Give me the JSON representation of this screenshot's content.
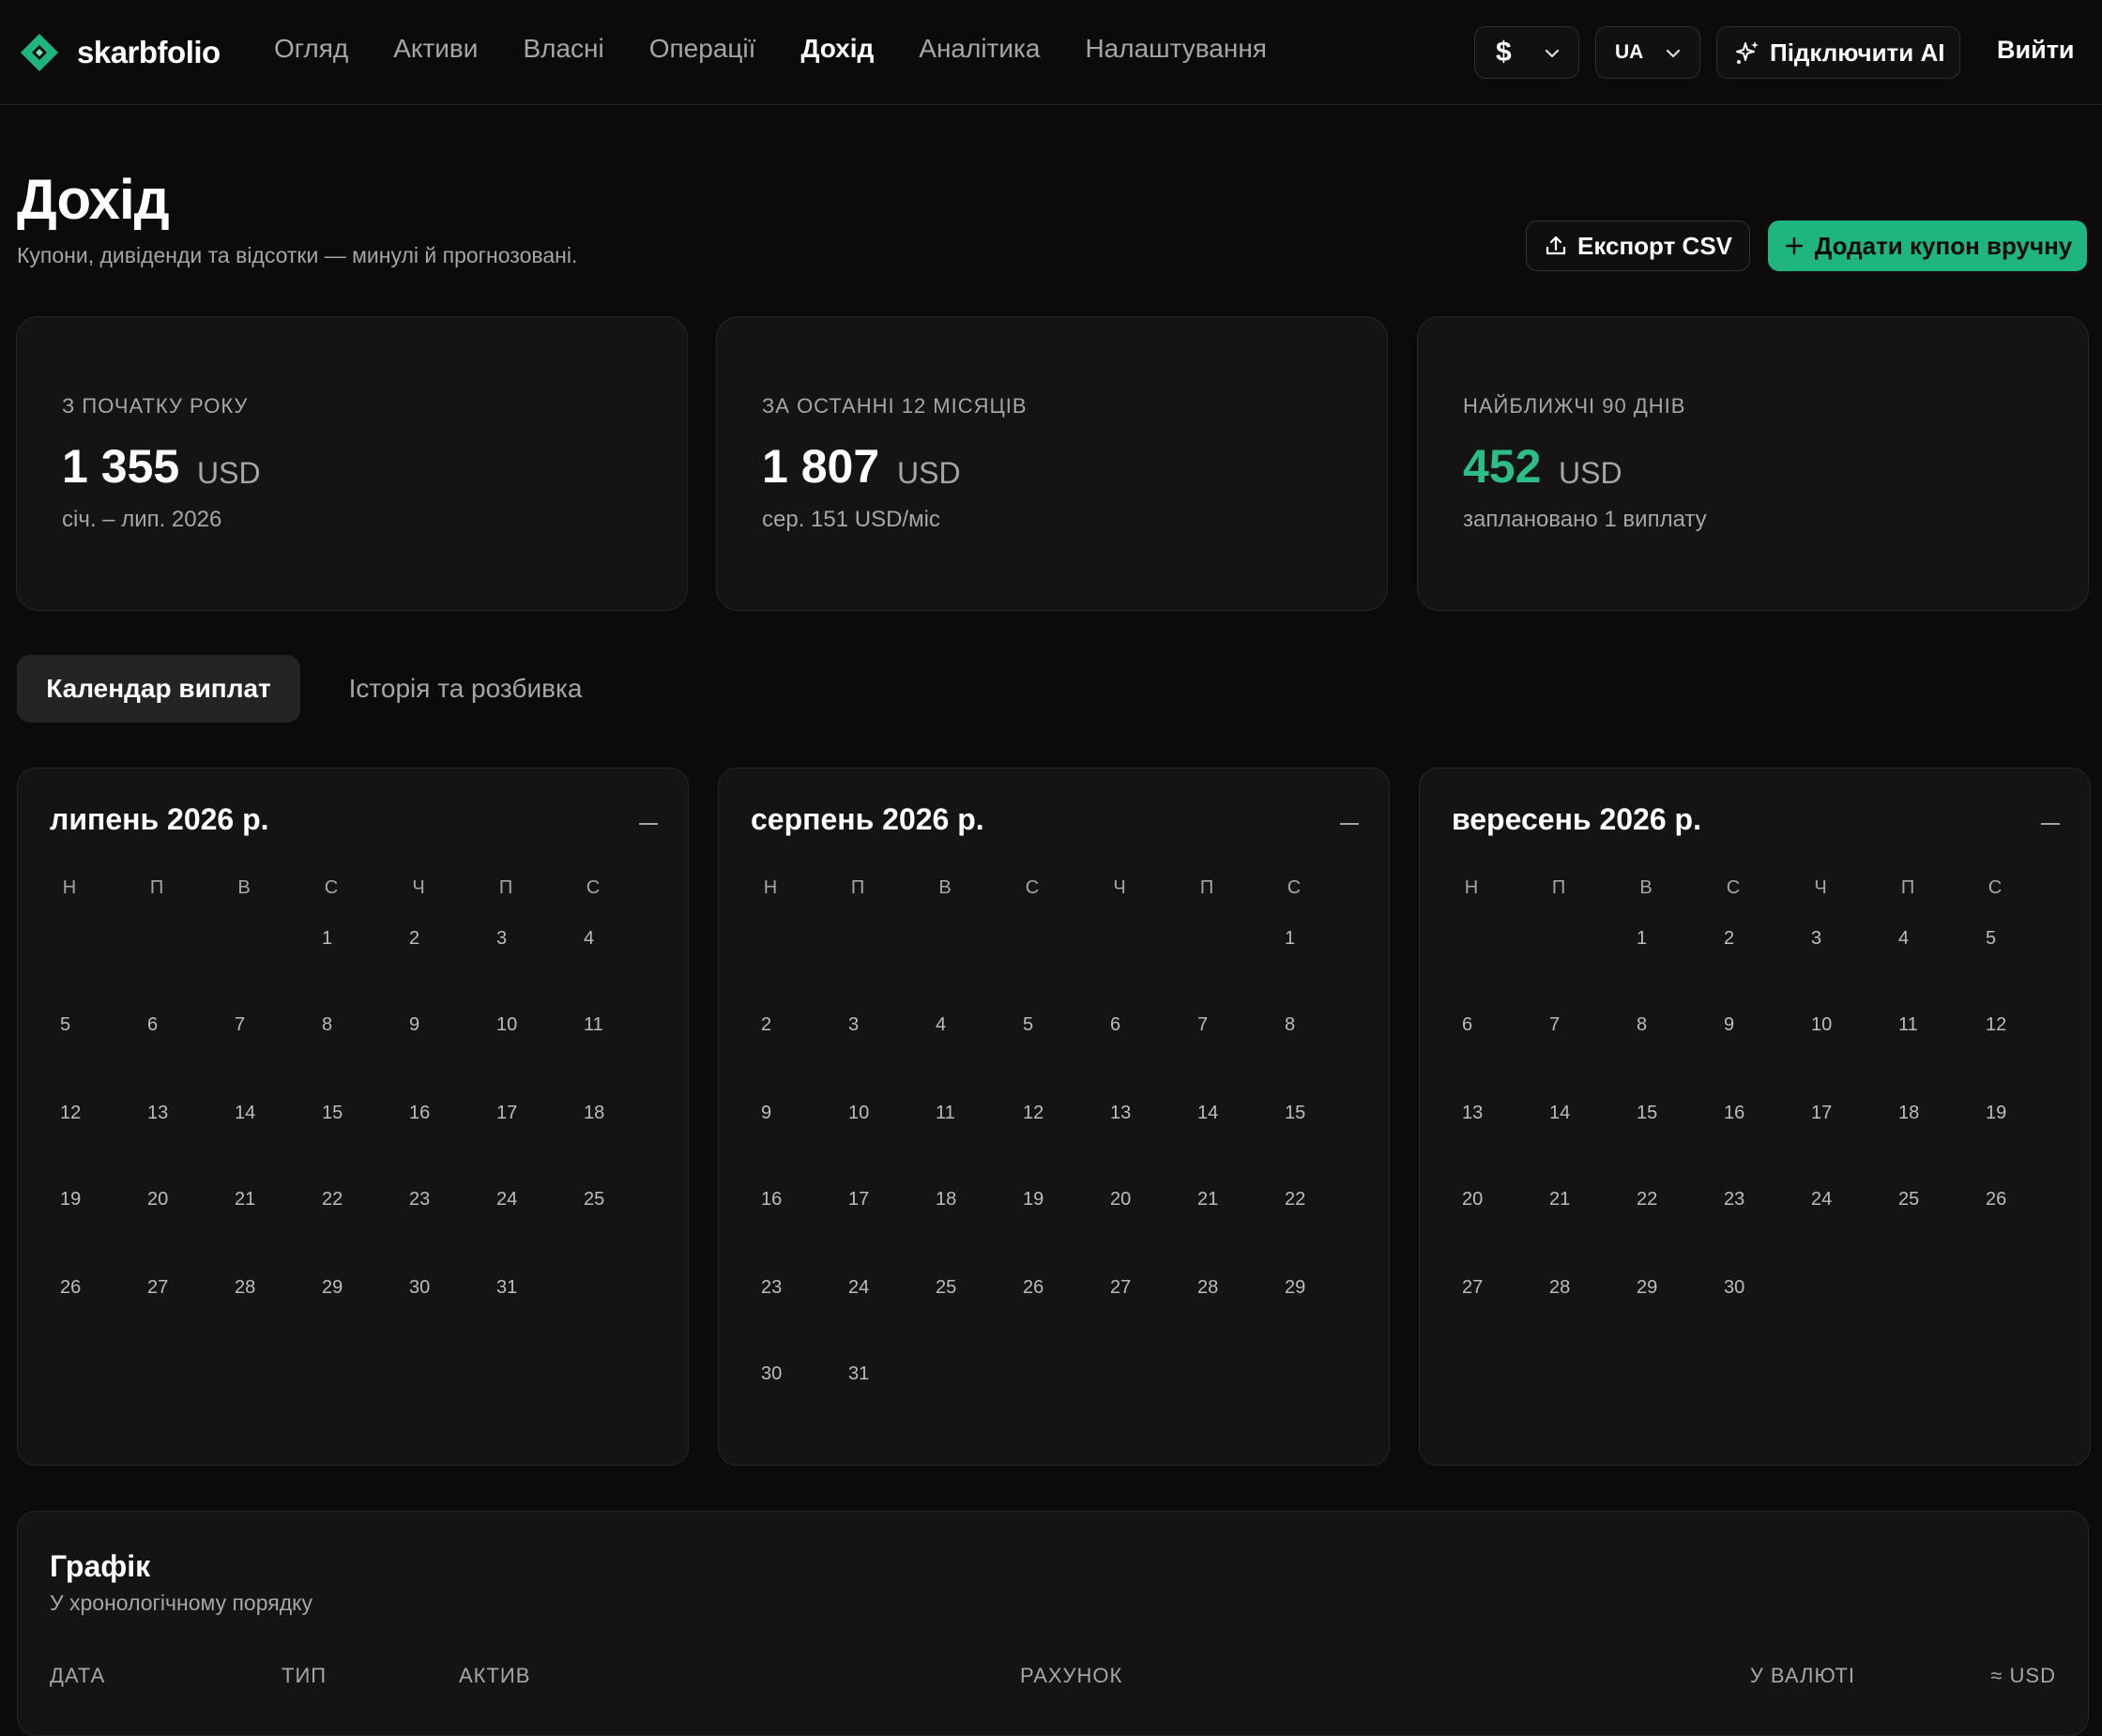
{
  "app": {
    "name": "skarbfolio",
    "brand_color": "#1fb57e"
  },
  "nav": {
    "items": [
      "Огляд",
      "Активи",
      "Власні",
      "Операції",
      "Дохід",
      "Аналітика",
      "Налаштування"
    ],
    "active": "Дохід"
  },
  "header": {
    "currency": "$",
    "language": "UA",
    "ai_button": "Підключити AI",
    "logout": "Вийти"
  },
  "page": {
    "title": "Дохід",
    "subtitle": "Купони, дивіденди та відсотки — минулі й прогнозовані."
  },
  "actions": {
    "export": "Експорт CSV",
    "add": "Додати купон вручну"
  },
  "stats": [
    {
      "label": "З ПОЧАТКУ РОКУ",
      "value": "1 355",
      "unit": "USD",
      "sub": "січ. – лип. 2026"
    },
    {
      "label": "ЗА ОСТАННІ 12 МІСЯЦІВ",
      "value": "1 807",
      "unit": "USD",
      "sub": "сер. 151 USD/міс"
    },
    {
      "label": "НАЙБЛИЖЧІ 90 ДНІВ",
      "value": "452",
      "unit": "USD",
      "sub": "заплановано 1 виплату"
    }
  ],
  "tabs": [
    "Календар виплат",
    "Історія та розбивка"
  ],
  "weekdays": [
    "Н",
    "П",
    "В",
    "С",
    "Ч",
    "П",
    "С"
  ],
  "calendars": [
    {
      "title": "липень 2026 р.",
      "first_weekday": 3,
      "days": 31
    },
    {
      "title": "серпень 2026 р.",
      "first_weekday": 6,
      "days": 31
    },
    {
      "title": "вересень 2026 р.",
      "first_weekday": 2,
      "days": 30
    }
  ],
  "schedule": {
    "title": "Графік",
    "subtitle": "У хронологічному порядку",
    "columns": [
      "ДАТА",
      "ТИП",
      "АКТИВ",
      "РАХУНОК",
      "У ВАЛЮТІ",
      "≈ USD"
    ]
  }
}
